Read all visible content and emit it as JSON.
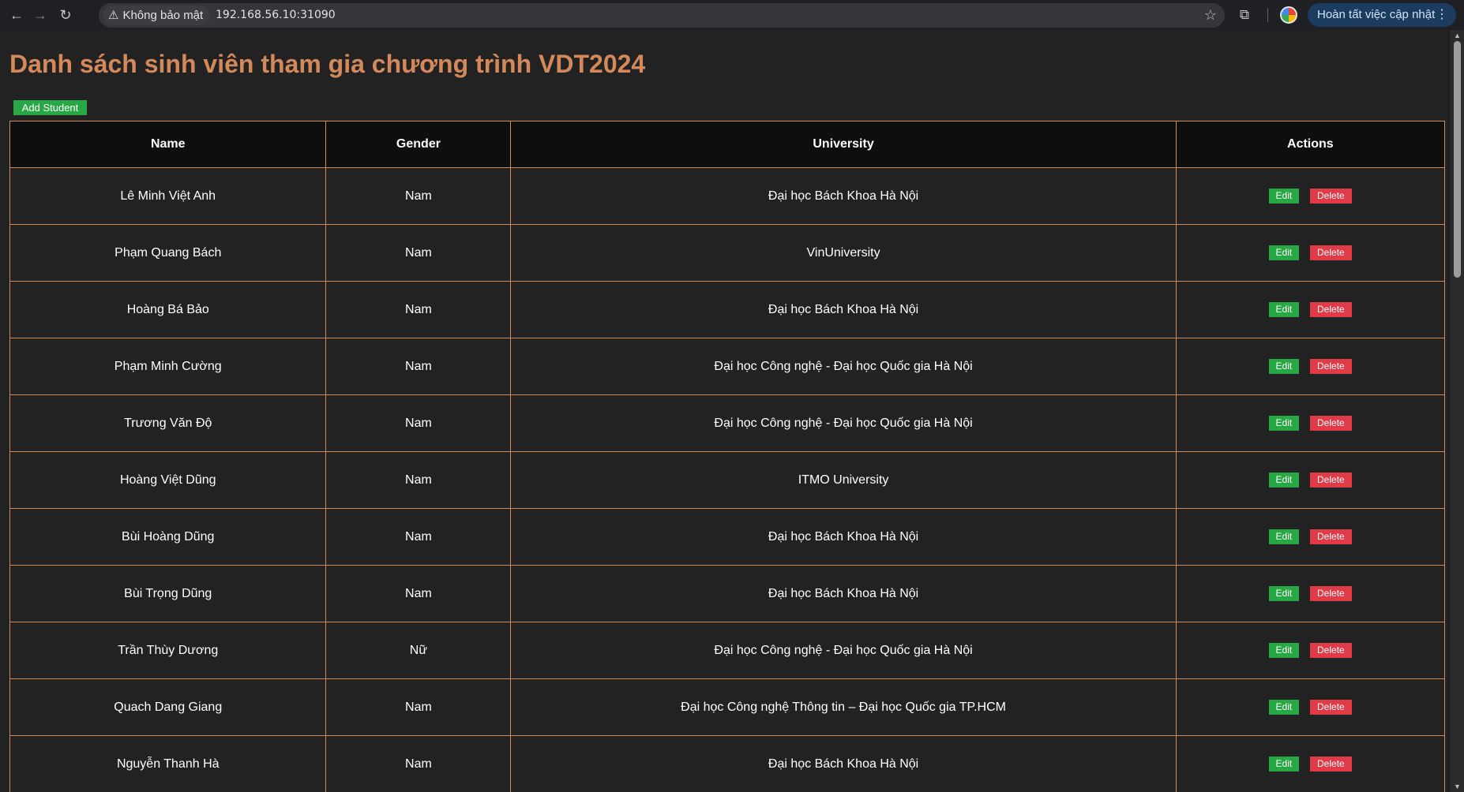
{
  "browser": {
    "security_label": "Không bảo mật",
    "url": "192.168.56.10:31090",
    "update_label": "Hoàn tất việc cập nhật"
  },
  "page": {
    "title": "Danh sách sinh viên tham gia chương trình VDT2024",
    "add_button": "Add Student"
  },
  "table": {
    "headers": [
      "Name",
      "Gender",
      "University",
      "Actions"
    ],
    "edit_label": "Edit",
    "delete_label": "Delete",
    "rows": [
      {
        "name": "Lê Minh Việt Anh",
        "gender": "Nam",
        "university": "Đại học Bách Khoa Hà Nội"
      },
      {
        "name": "Phạm Quang Bách",
        "gender": "Nam",
        "university": "VinUniversity"
      },
      {
        "name": "Hoàng Bá Bảo",
        "gender": "Nam",
        "university": "Đại học Bách Khoa Hà Nội"
      },
      {
        "name": "Phạm Minh Cường",
        "gender": "Nam",
        "university": "Đại học Công nghệ - Đại học Quốc gia Hà Nội"
      },
      {
        "name": "Trương Văn Độ",
        "gender": "Nam",
        "university": "Đại học Công nghệ - Đại học Quốc gia Hà Nội"
      },
      {
        "name": "Hoàng Việt Dũng",
        "gender": "Nam",
        "university": "ITMO University"
      },
      {
        "name": "Bùi Hoàng Dũng",
        "gender": "Nam",
        "university": "Đại học Bách Khoa Hà Nội"
      },
      {
        "name": "Bùi Trọng Dũng",
        "gender": "Nam",
        "university": "Đại học Bách Khoa Hà Nội"
      },
      {
        "name": "Trần Thùy Dương",
        "gender": "Nữ",
        "university": "Đại học Công nghệ - Đại học Quốc gia Hà Nội"
      },
      {
        "name": "Quach Dang Giang",
        "gender": "Nam",
        "university": "Đại học Công nghệ Thông tin – Đại học Quốc gia TP.HCM"
      },
      {
        "name": "Nguyễn Thanh Hà",
        "gender": "Nam",
        "university": "Đại học Bách Khoa Hà Nội"
      }
    ]
  },
  "colors": {
    "title": "#d4895a",
    "border": "#d4895a",
    "edit": "#28a745",
    "delete": "#e03b46",
    "background": "#222222"
  }
}
